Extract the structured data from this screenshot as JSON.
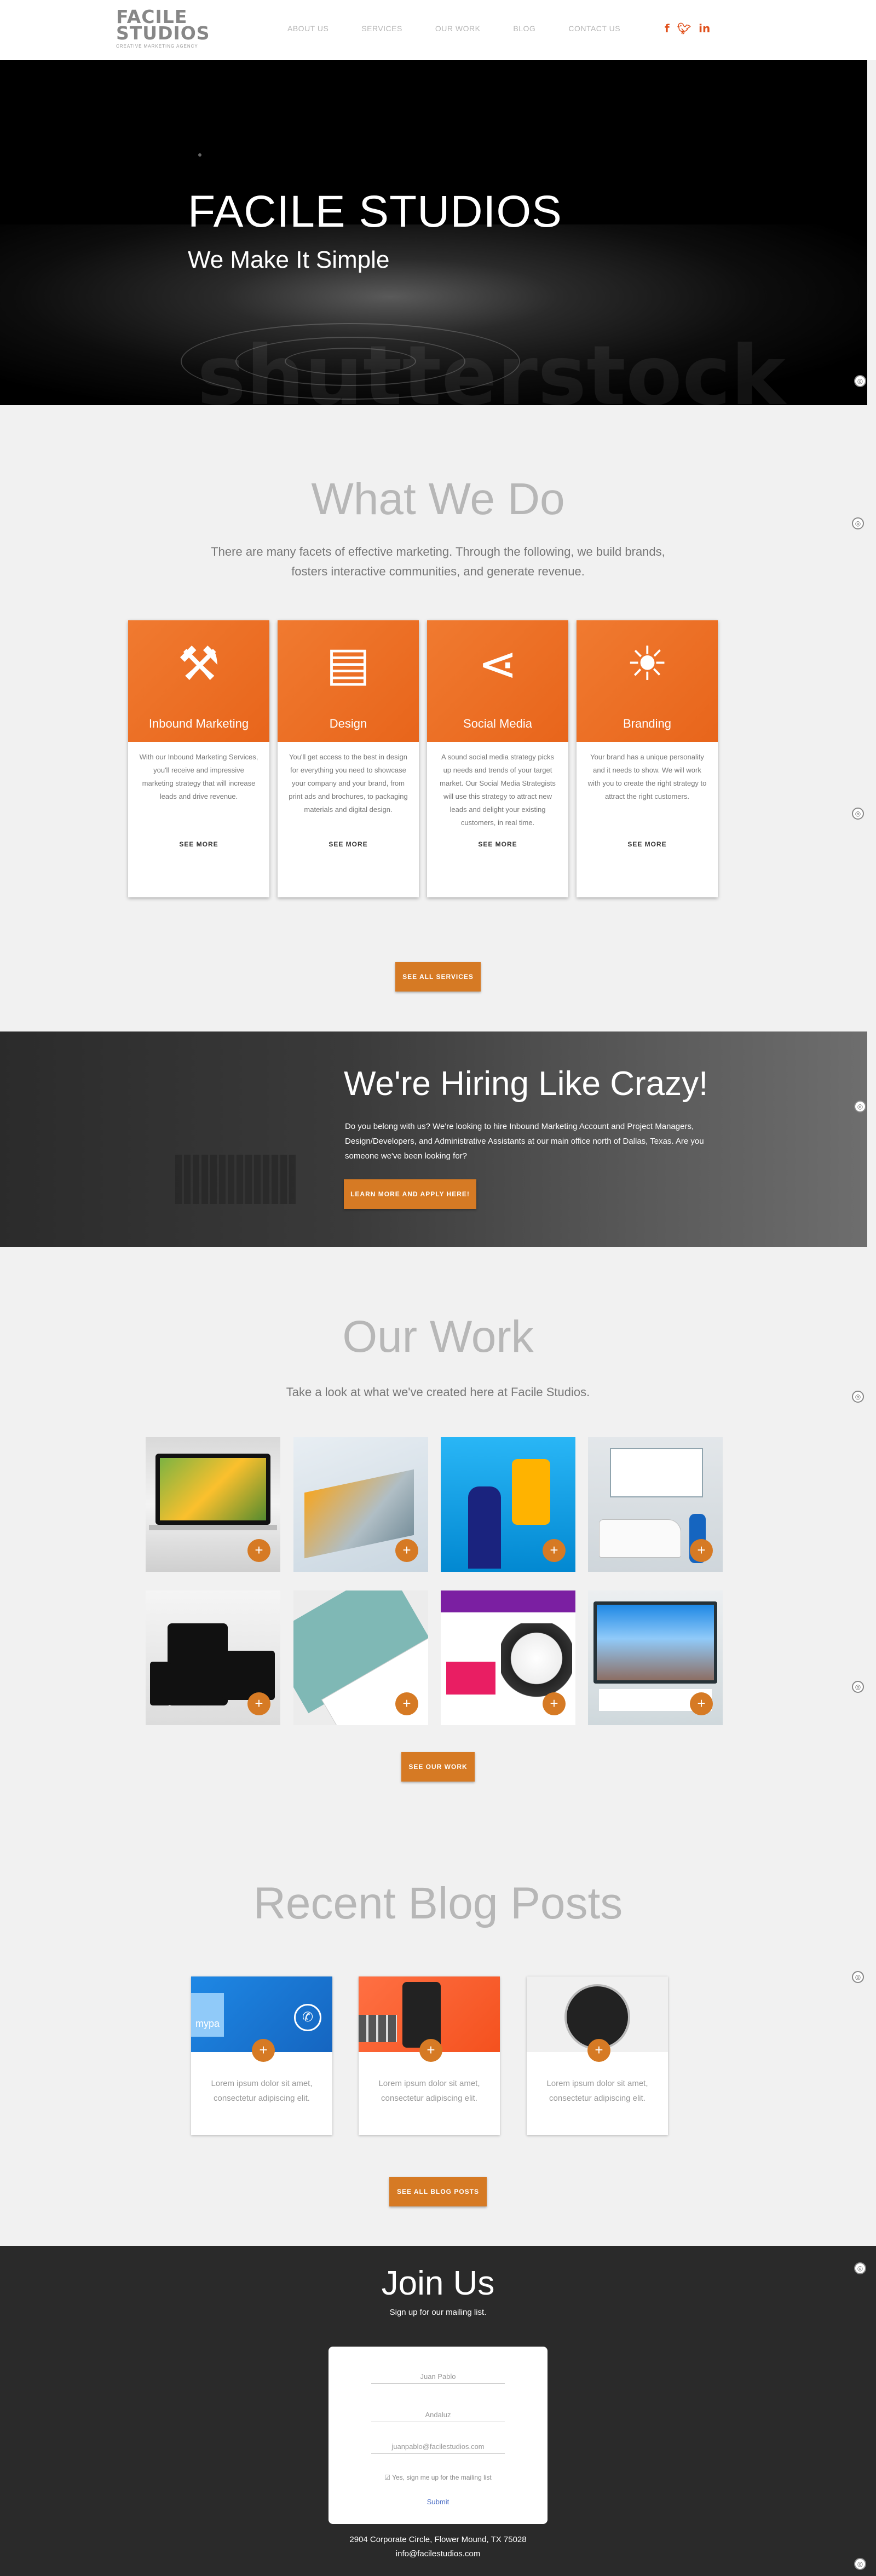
{
  "brand": {
    "line1": "FACILE",
    "line2": "STUDIOS",
    "tagline": "CREATIVE MARKETING AGENCY"
  },
  "nav": {
    "items": [
      "ABOUT US",
      "SERVICES",
      "OUR WORK",
      "BLOG",
      "CONTACT US"
    ]
  },
  "socials": {
    "facebook": "f",
    "twitter": "t",
    "linkedin": "in"
  },
  "hero": {
    "title": "FACILE STUDIOS",
    "subtitle": "We Make It Simple",
    "watermark": "shutterstock"
  },
  "what_we_do": {
    "title": "What We Do",
    "intro": "There are many facets of effective marketing. Through the following, we build brands, fosters interactive communities, and generate revenue.",
    "services": [
      {
        "name": "Inbound Marketing",
        "icon": "magnet-icon",
        "glyph": "⚒",
        "text": "With our Inbound Marketing Services, you'll receive and impressive marketing strategy that will increase leads and drive revenue.",
        "cta": "SEE MORE"
      },
      {
        "name": "Design",
        "icon": "palette-icon",
        "glyph": "▤",
        "text": "You'll get access to the best in design for everything you need to showcase your company and your brand, from print ads and brochures, to packaging materials and digital design.",
        "cta": "SEE MORE"
      },
      {
        "name": "Social Media",
        "icon": "share-icon",
        "glyph": "⋖",
        "text": "A sound social media strategy picks up needs and trends of your target market. Our Social Media Strategists will use this strategy to attract new leads and delight your existing customers, in real time.",
        "cta": "SEE MORE"
      },
      {
        "name": "Branding",
        "icon": "lightbulb-icon",
        "glyph": "☀",
        "text": "Your brand has a unique personality and it needs to show. We will work with you to create the right strategy to attract the right customers.",
        "cta": "SEE MORE"
      }
    ],
    "all_button": "SEE ALL SERVICES"
  },
  "hiring": {
    "title": "We're Hiring Like Crazy!",
    "text": "Do you belong with us? We're looking to hire Inbound Marketing Account and Project Managers, Design/Developers, and Administrative Assistants at our main office north of Dallas, Texas. Are you someone we've been looking for?",
    "button": "LEARN MORE AND APPLY HERE!"
  },
  "our_work": {
    "title": "Our Work",
    "intro": "Take a look at what we've created here at Facile Studios.",
    "plus": "+",
    "button": "SEE OUR WORK"
  },
  "blog": {
    "title": "Recent Blog Posts",
    "posts": [
      {
        "text": "Lorem ipsum dolor sit amet, consectetur adipiscing elit.",
        "badge": "mypa"
      },
      {
        "text": "Lorem ipsum dolor sit amet, consectetur adipiscing elit."
      },
      {
        "text": "Lorem ipsum dolor sit amet, consectetur adipiscing elit."
      }
    ],
    "button": "SEE ALL BLOG POSTS"
  },
  "join": {
    "title": "Join Us",
    "subtitle": "Sign up for our mailing list.",
    "form": {
      "first_name": "Juan Pablo",
      "last_name": "Andaluz",
      "email": "juanpablo@facilestudios.com",
      "checkbox_label": "Yes, sign me up for the mailing list",
      "submit": "Submit"
    },
    "address": "2904 Corporate Circle, Flower Mound, TX 75028",
    "email": "info@facilestudios.com"
  },
  "colors": {
    "accent": "#d67a24",
    "orange": "#e8651b",
    "dark": "#2a2a2a"
  }
}
